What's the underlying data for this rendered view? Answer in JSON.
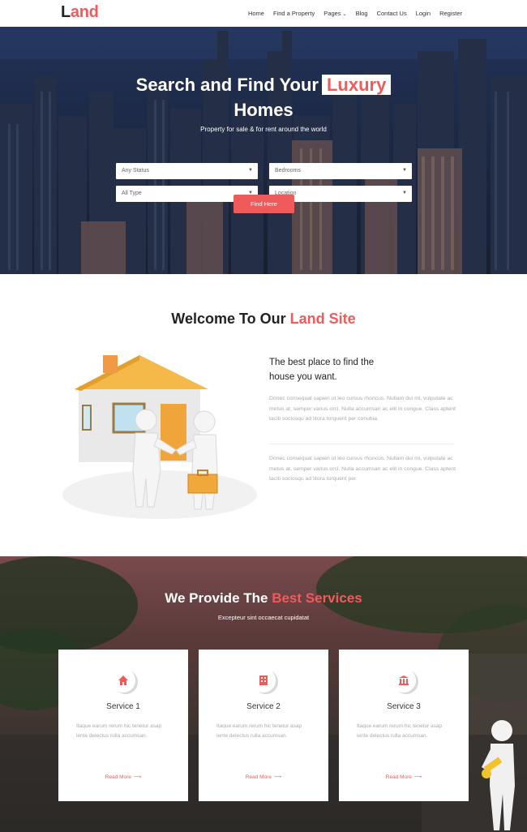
{
  "brand": {
    "first": "L",
    "rest": "and",
    "accent": "#ef5b5b"
  },
  "nav": [
    {
      "label": "Home"
    },
    {
      "label": "Find a Property"
    },
    {
      "label": "Pages",
      "caret": "⌄"
    },
    {
      "label": "Blog"
    },
    {
      "label": "Contact Us"
    },
    {
      "label": "Login"
    },
    {
      "label": "Register"
    }
  ],
  "hero": {
    "title_a": "Search and Find Your",
    "title_highlight": "Luxury",
    "title_b": "Homes",
    "subtitle": "Property for sale & for rent around the world",
    "selects": [
      {
        "value": "Any Status"
      },
      {
        "value": "Bedrooms"
      },
      {
        "value": "All Type"
      },
      {
        "value": "Location"
      }
    ],
    "button": "Find Here"
  },
  "welcome": {
    "title_a": "Welcome To Our",
    "title_highlight": "Land Site",
    "heading_line1": "The best place to find the",
    "heading_line2": "house you want.",
    "para1": "Donec consequat sapien ut leo cursus rhoncus. Nullam dui mi, vulputate ac metus at, semper varius orci. Nulla accumsan ac elit in congue. Class aptent taciti sociosqu ad litora torquent per conubia.",
    "para2": "Donec consequat sapien ut leo cursus rhoncus. Nullam dui mi, vulputate ac metus at, semper varius orci. Nulla accumsan ac elit in congue. Class aptent taciti sociosqu ad litora torquent per."
  },
  "services": {
    "title_a": "We Provide The",
    "title_highlight": "Best Services",
    "subtitle": "Excepteur sint occaecat cupidatat",
    "cards": [
      {
        "icon": "home-icon",
        "title": "Service 1",
        "text": "Itaque earum rerum hic tenetur asap iente delectus rulla accumsan.",
        "more": "Read More"
      },
      {
        "icon": "building-icon",
        "title": "Service 2",
        "text": "Itaque earum rerum hic tenetur asap iente delectus rulla accumsan.",
        "more": "Read More"
      },
      {
        "icon": "bank-icon",
        "title": "Service 3",
        "text": "Itaque earum rerum hic tenetur asap iente delectus rulla accumsan.",
        "more": "Read More"
      }
    ]
  }
}
